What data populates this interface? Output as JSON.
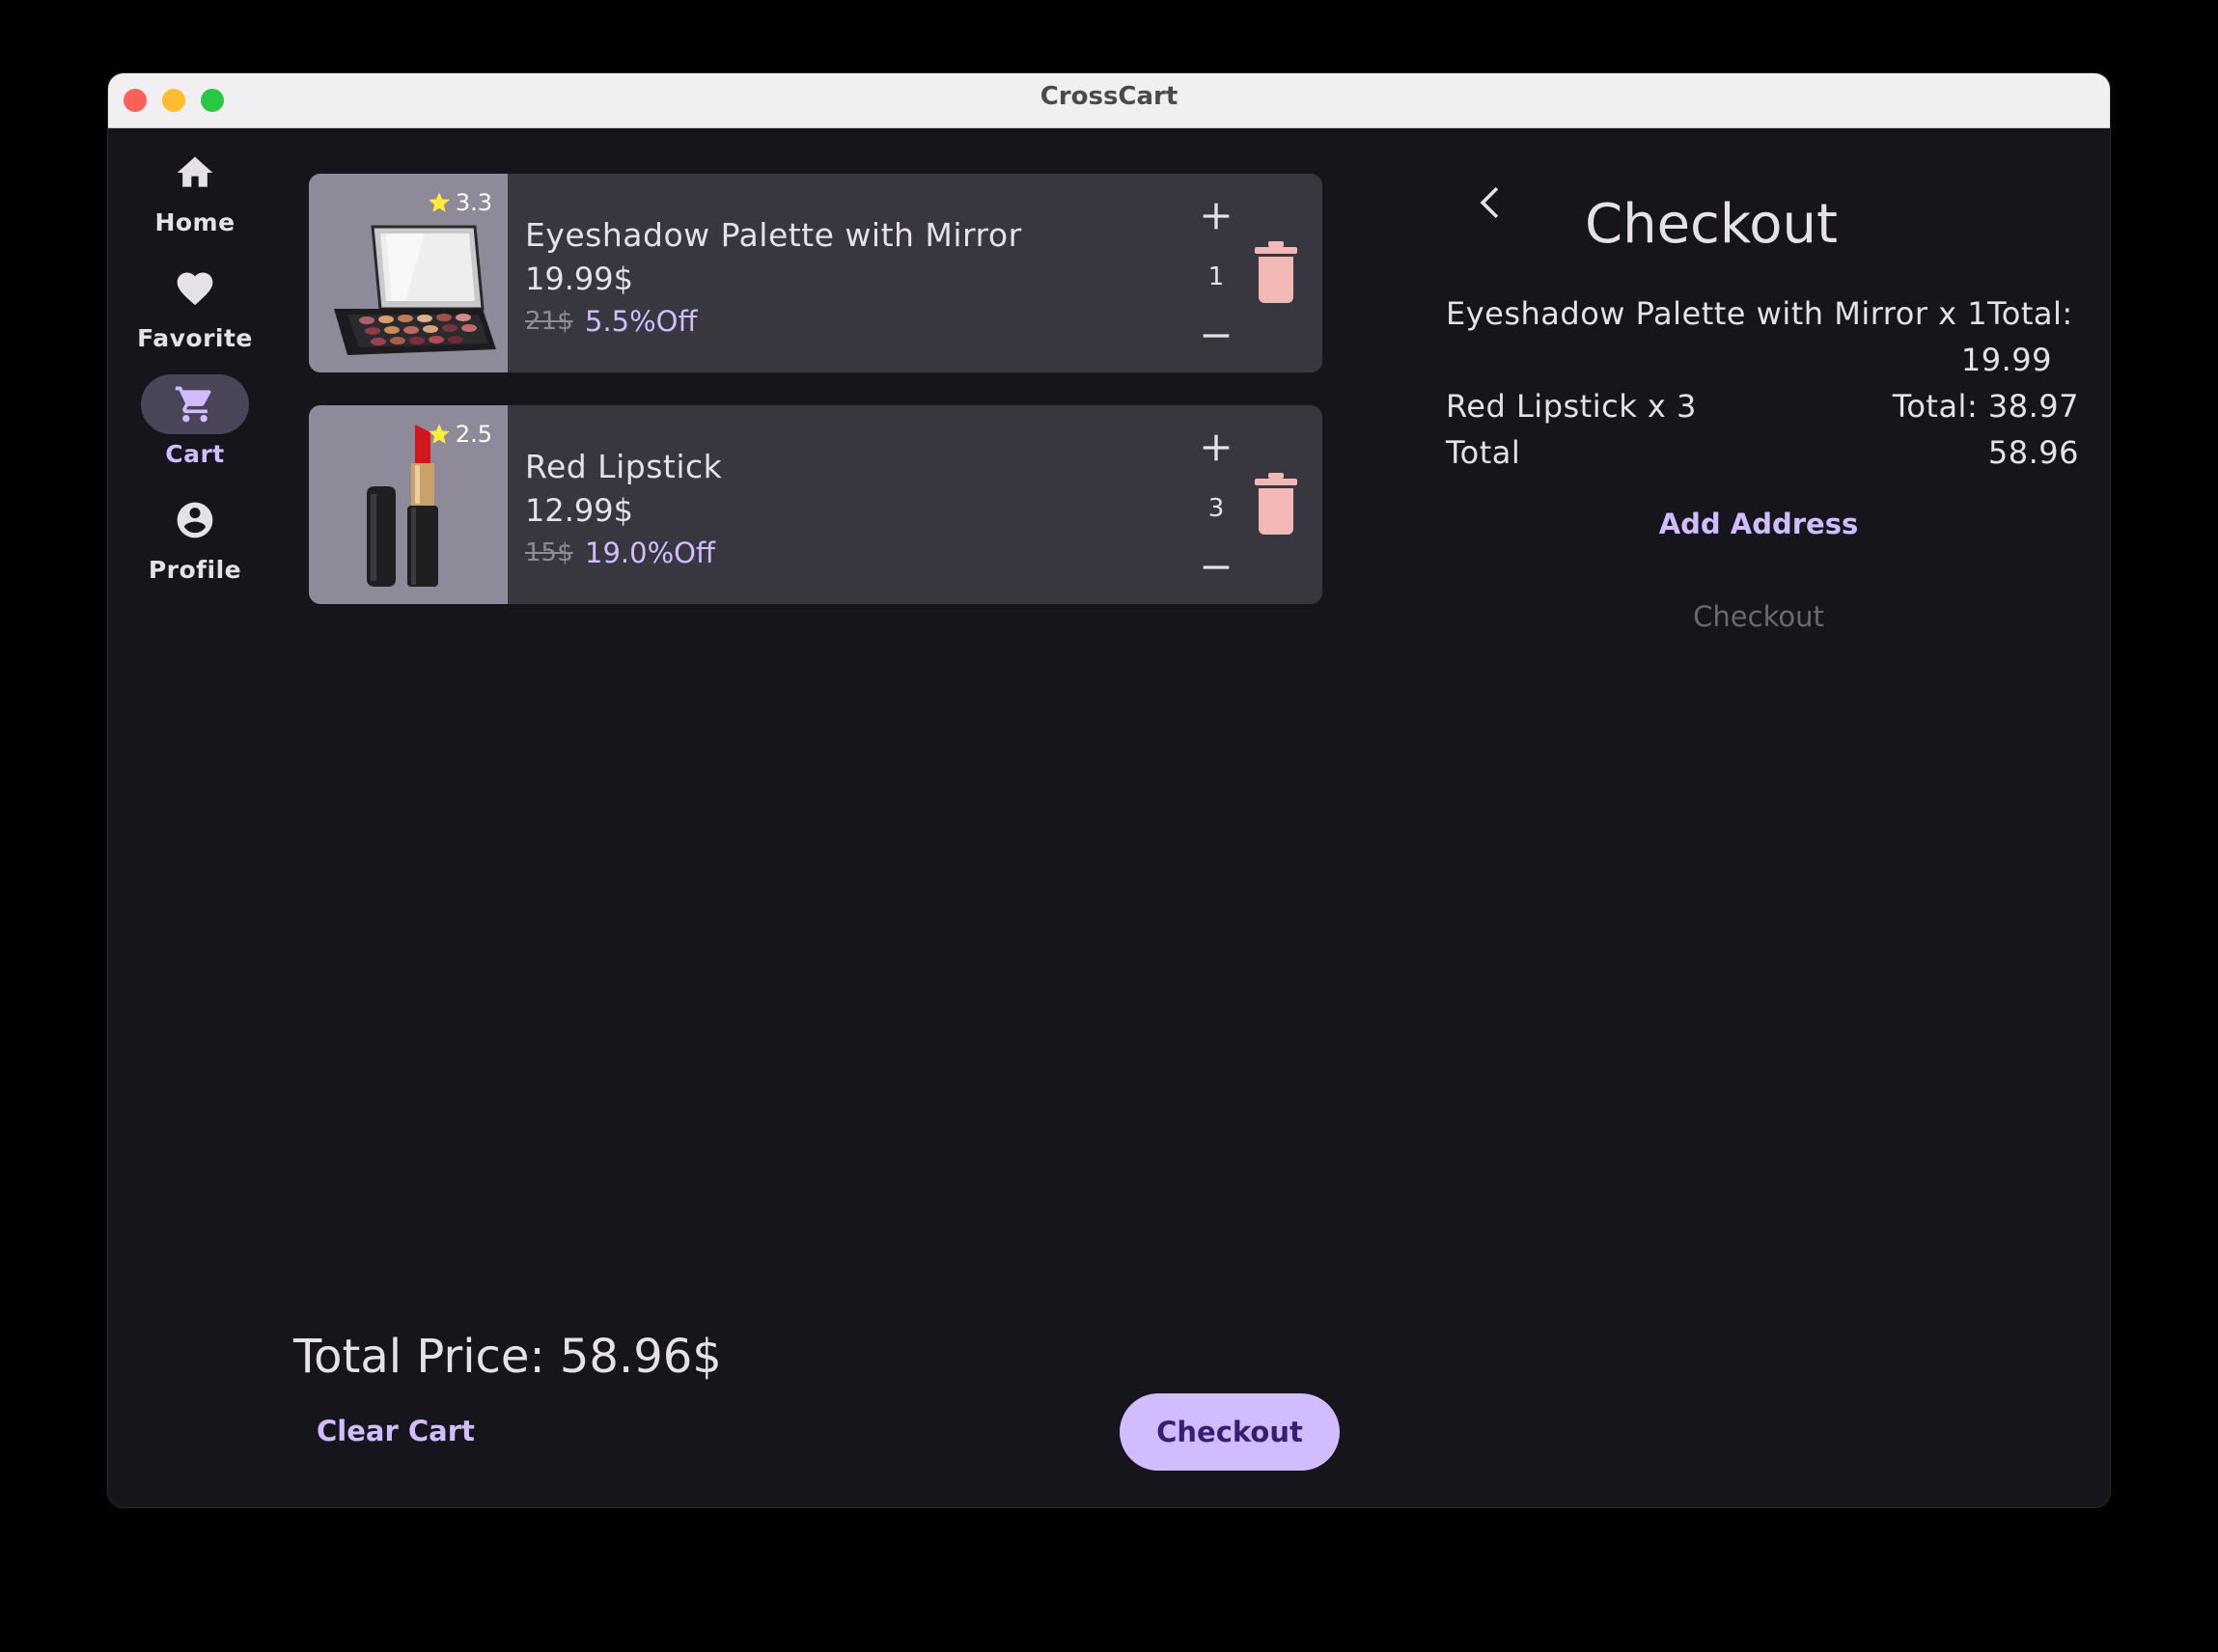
{
  "window": {
    "title": "CrossCart"
  },
  "nav": {
    "items": [
      {
        "label": "Home",
        "icon": "home-icon",
        "active": false
      },
      {
        "label": "Favorite",
        "icon": "heart-icon",
        "active": false
      },
      {
        "label": "Cart",
        "icon": "cart-icon",
        "active": true
      },
      {
        "label": "Profile",
        "icon": "account-circle-icon",
        "active": false
      }
    ]
  },
  "cart": {
    "items": [
      {
        "name": "Eyeshadow Palette with Mirror",
        "price": "19.99$",
        "old_price": "21$",
        "discount": "5.5%Off",
        "rating": "3.3",
        "quantity": "1"
      },
      {
        "name": "Red Lipstick",
        "price": "12.99$",
        "old_price": "15$",
        "discount": "19.0%Off",
        "rating": "2.5",
        "quantity": "3"
      }
    ],
    "total_price": "Total Price: 58.96$",
    "clear_label": "Clear Cart",
    "checkout_label": "Checkout"
  },
  "checkout_panel": {
    "title": "Checkout",
    "line1_name": "Eyeshadow Palette with Mirror x 1",
    "line1_total_label": "Total:",
    "line1_total_value": "19.99",
    "line2_name": "Red Lipstick x 3",
    "line2_total": "Total: 38.97",
    "total_label": "Total",
    "total_value": "58.96",
    "add_address_label": "Add Address",
    "checkout_label": "Checkout"
  },
  "colors": {
    "accent": "#d0bcff",
    "background": "#16151b",
    "card": "#38363f",
    "trash": "#f2b8b5",
    "star": "#ffeb3b"
  }
}
